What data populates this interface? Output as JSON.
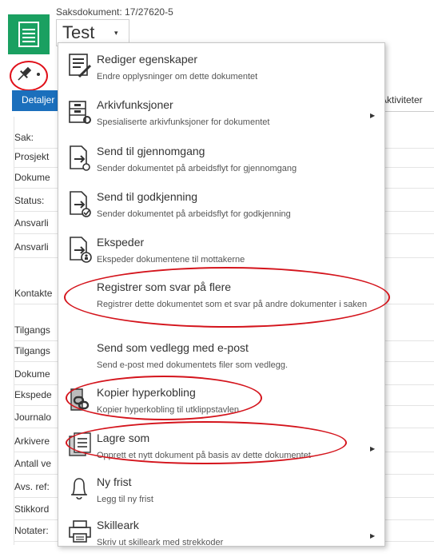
{
  "header": {
    "subtitle": "Saksdokument: 17/27620-5",
    "title": "Test",
    "title_caret": "▾"
  },
  "tabs": {
    "detail": "Detaljer",
    "activities": "Aktiviteter"
  },
  "fields": [
    {
      "label": "Sak:"
    },
    {
      "label": "Prosjekt"
    },
    {
      "label": "Dokume"
    },
    {
      "label": "Status:"
    },
    {
      "label": "Ansvarli"
    },
    {
      "label": "Ansvarli"
    },
    {
      "label": "Kontakte"
    },
    {
      "label": "Tilgangs"
    },
    {
      "label": "Tilgangs"
    },
    {
      "label": "Dokume"
    },
    {
      "label": "Ekspede"
    },
    {
      "label": "Journalo"
    },
    {
      "label": "Arkivere"
    },
    {
      "label": "Antall ve"
    },
    {
      "label": "Avs. ref:"
    },
    {
      "label": "Stikkord"
    },
    {
      "label": "Notater:"
    }
  ],
  "menu": [
    {
      "title": "Rediger egenskaper",
      "desc": "Endre opplysninger om dette dokumentet",
      "icon": "edit-properties-icon",
      "submenu": false
    },
    {
      "title": "Arkivfunksjoner",
      "desc": "Spesialiserte arkivfunksjoner for dokumentet",
      "icon": "archive-cabinet-icon",
      "submenu": true
    },
    {
      "title": "Send til gjennomgang",
      "desc": "Sender dokumentet på arbeidsflyt for gjennomgang",
      "icon": "send-review-icon",
      "submenu": false
    },
    {
      "title": "Send til godkjenning",
      "desc": "Sender dokumentet på arbeidsflyt for godkjenning",
      "icon": "send-approval-icon",
      "submenu": false
    },
    {
      "title": "Ekspeder",
      "desc": "Ekspeder dokumentene til mottakerne",
      "icon": "dispatch-icon",
      "submenu": false
    },
    {
      "title": "Registrer som svar på flere",
      "desc": "Registrer dette dokumentet som et svar på andre dokumenter i saken",
      "icon": "",
      "submenu": false
    },
    {
      "title": "Send som vedlegg med e-post",
      "desc": "Send e-post med dokumentets filer som vedlegg.",
      "icon": "",
      "submenu": false
    },
    {
      "title": "Kopier hyperkobling",
      "desc": "Kopier hyperkobling til utklippstavlen",
      "icon": "hyperlink-icon",
      "submenu": false
    },
    {
      "title": "Lagre som",
      "desc": "Opprett et nytt dokument på basis av dette dokumentet",
      "icon": "save-as-icon",
      "submenu": true
    },
    {
      "title": "Ny frist",
      "desc": "Legg til ny frist",
      "icon": "bell-icon",
      "submenu": false
    },
    {
      "title": "Skilleark",
      "desc": "Skriv ut skilleark med strekkoder",
      "icon": "printer-icon",
      "submenu": true
    }
  ],
  "submenu_arrow": "▶",
  "colors": {
    "accent": "#1b6fbc",
    "doc_icon": "#1aa061",
    "annotation": "#d4141c"
  }
}
